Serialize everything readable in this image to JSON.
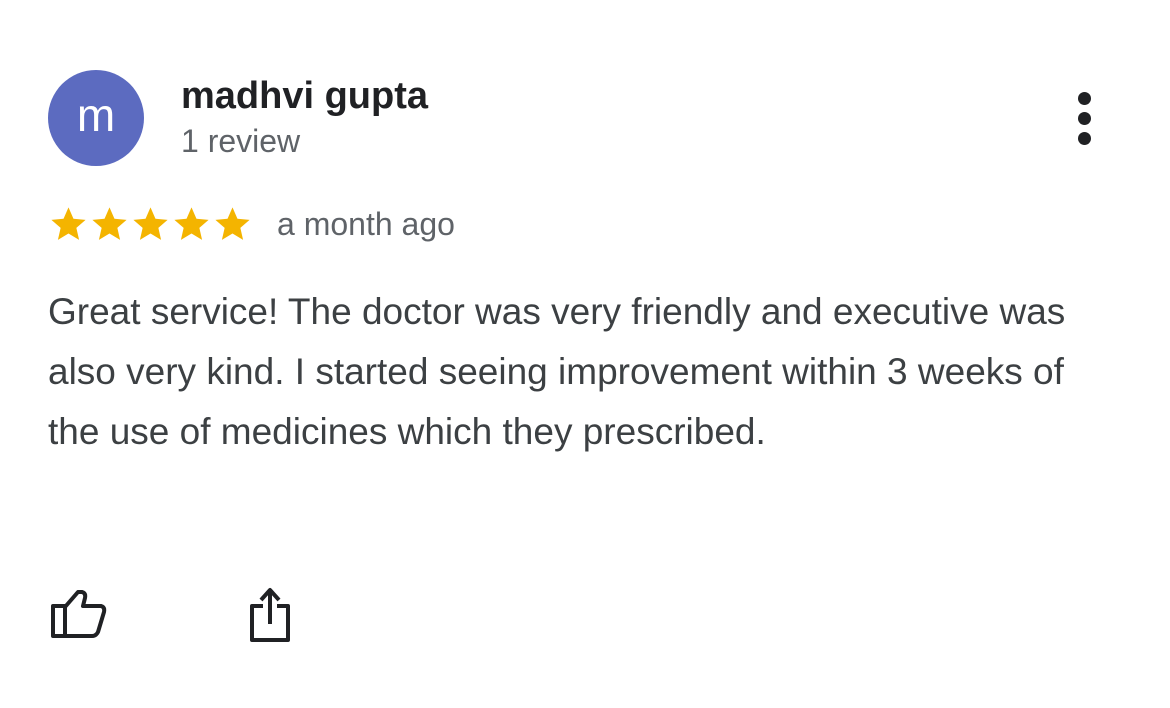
{
  "review": {
    "author": {
      "initial": "m",
      "name": "madhvi gupta",
      "meta": "1 review",
      "avatar_color": "#5c6bc0"
    },
    "rating": 5,
    "rating_max": 5,
    "star_color": "#f4b400",
    "date": "a month ago",
    "text": "Great service! The doctor was very friendly and executive was also very kind. I started seeing improvement within 3 weeks of the use of medicines which they prescribed.",
    "actions": {
      "like_icon": "thumbs-up-icon",
      "share_icon": "share-icon",
      "more_icon": "more-vert-icon"
    }
  }
}
